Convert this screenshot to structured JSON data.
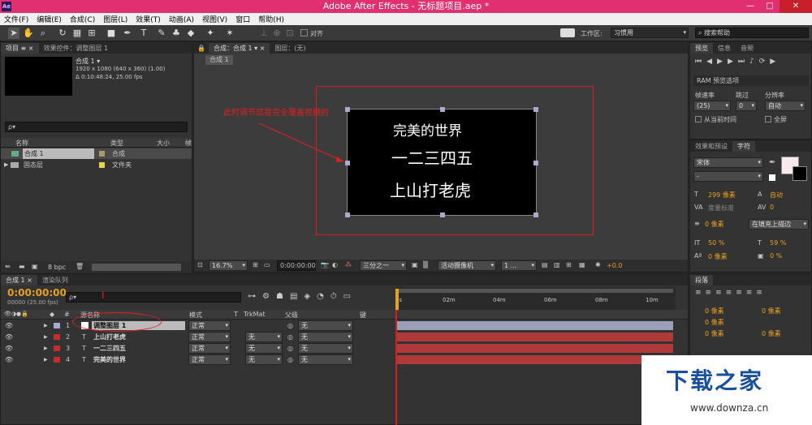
{
  "window": {
    "title": "Adobe After Effects - 无标题项目.aep *",
    "app_icon": "Ae",
    "minimize": "—",
    "maximize": "□",
    "close": "✕"
  },
  "menu": [
    "文件(F)",
    "编辑(E)",
    "合成(C)",
    "图层(L)",
    "效果(T)",
    "动画(A)",
    "视图(V)",
    "窗口",
    "帮助(H)"
  ],
  "toolbar": {
    "align_label": "对齐",
    "workspace_label": "工作区:",
    "workspace_value": "习惯用",
    "search_placeholder": "搜索帮助"
  },
  "project_panel": {
    "tabs": [
      "项目 ≡ ×",
      "效果控件：调整图层 1"
    ],
    "comp_name": "合成 1 ▾",
    "comp_info1": "1920 x 1080  (640 x 360) (1.00)",
    "comp_info2": "Δ 0:10:48:24, 25.00 fps",
    "search_value": "ρ▾",
    "columns": [
      "名称",
      "类型",
      "大小",
      "帧"
    ],
    "items": [
      {
        "name": "合成 1",
        "type": "合成"
      },
      {
        "name": "固态层",
        "type": "文件夹"
      }
    ],
    "bpc": "8 bpc"
  },
  "comp_panel": {
    "tab": "合成：合成 1 ▾ ×",
    "subtab": "合成 1",
    "text_lines": [
      "完美的世界",
      "一二三四五",
      "上山打老虎"
    ],
    "annotation": "此时调节层是完全覆盖视频的",
    "zoom": "16.7%",
    "time": "0:00:00:00",
    "resolution": "三分之一",
    "camera": "活动摄像机",
    "views": "1 ...",
    "exposure": "+0.0"
  },
  "preview_panel": {
    "tabs": [
      "预览",
      "信息",
      "音频"
    ],
    "ram_label": "RAM 预览选项",
    "frame_rate_label": "帧速率",
    "skip_label": "跳过",
    "resolution_label": "分辨率",
    "frame_rate": "(25)",
    "skip": "0",
    "resolution": "自动",
    "from_current": "从当前时间",
    "fullscreen": "全屏"
  },
  "char_panel": {
    "tabs": [
      "效果和预设",
      "字符"
    ],
    "font": "宋体",
    "style": "-",
    "size": "299 像素",
    "leading": "自动",
    "kerning": "度量标准",
    "tracking": "0",
    "stroke": "0 像素",
    "stroke_mode": "在填充上描边",
    "vscale": "50 %",
    "hscale": "59 %",
    "baseline": "0 像素",
    "tsume": "0 %"
  },
  "para_panel": {
    "tab": "段落",
    "indent1": "0 像素",
    "indent2": "0 像素",
    "indent3": "0 像素",
    "space1": "0 像素",
    "space2": "0 像素"
  },
  "timeline": {
    "tabs": [
      "合成 1 ×",
      "渲染队列"
    ],
    "timecode": "0:00:00:00",
    "fps": "00000 (25.00 fps)",
    "search": "ρ▾",
    "cursor_mark": "I",
    "ruler": [
      "0s",
      "02m",
      "04m",
      "06m",
      "08m",
      "10m"
    ],
    "columns": {
      "num": "#",
      "name": "源名称",
      "mode": "模式",
      "t": "T",
      "trkmat": "TrkMat",
      "parent": "父级",
      "key": "键"
    },
    "layers": [
      {
        "num": "1",
        "name": "调整图层 1",
        "mode": "正常",
        "trkmat": "",
        "parent": "无"
      },
      {
        "num": "2",
        "name": "上山打老虎",
        "mode": "正常",
        "trkmat": "无",
        "parent": "无"
      },
      {
        "num": "3",
        "name": "一二三四五",
        "mode": "正常",
        "trkmat": "无",
        "parent": "无"
      },
      {
        "num": "4",
        "name": "完美的世界",
        "mode": "正常",
        "trkmat": "无",
        "parent": "无"
      }
    ]
  },
  "watermark": {
    "name": "下载之家",
    "url": "www.downza.cn"
  },
  "colors": {
    "titlebar": "#e03070",
    "annotation": "#e02020",
    "layer_bar": "#b03a3a",
    "watermark": "#1a4fa0"
  }
}
